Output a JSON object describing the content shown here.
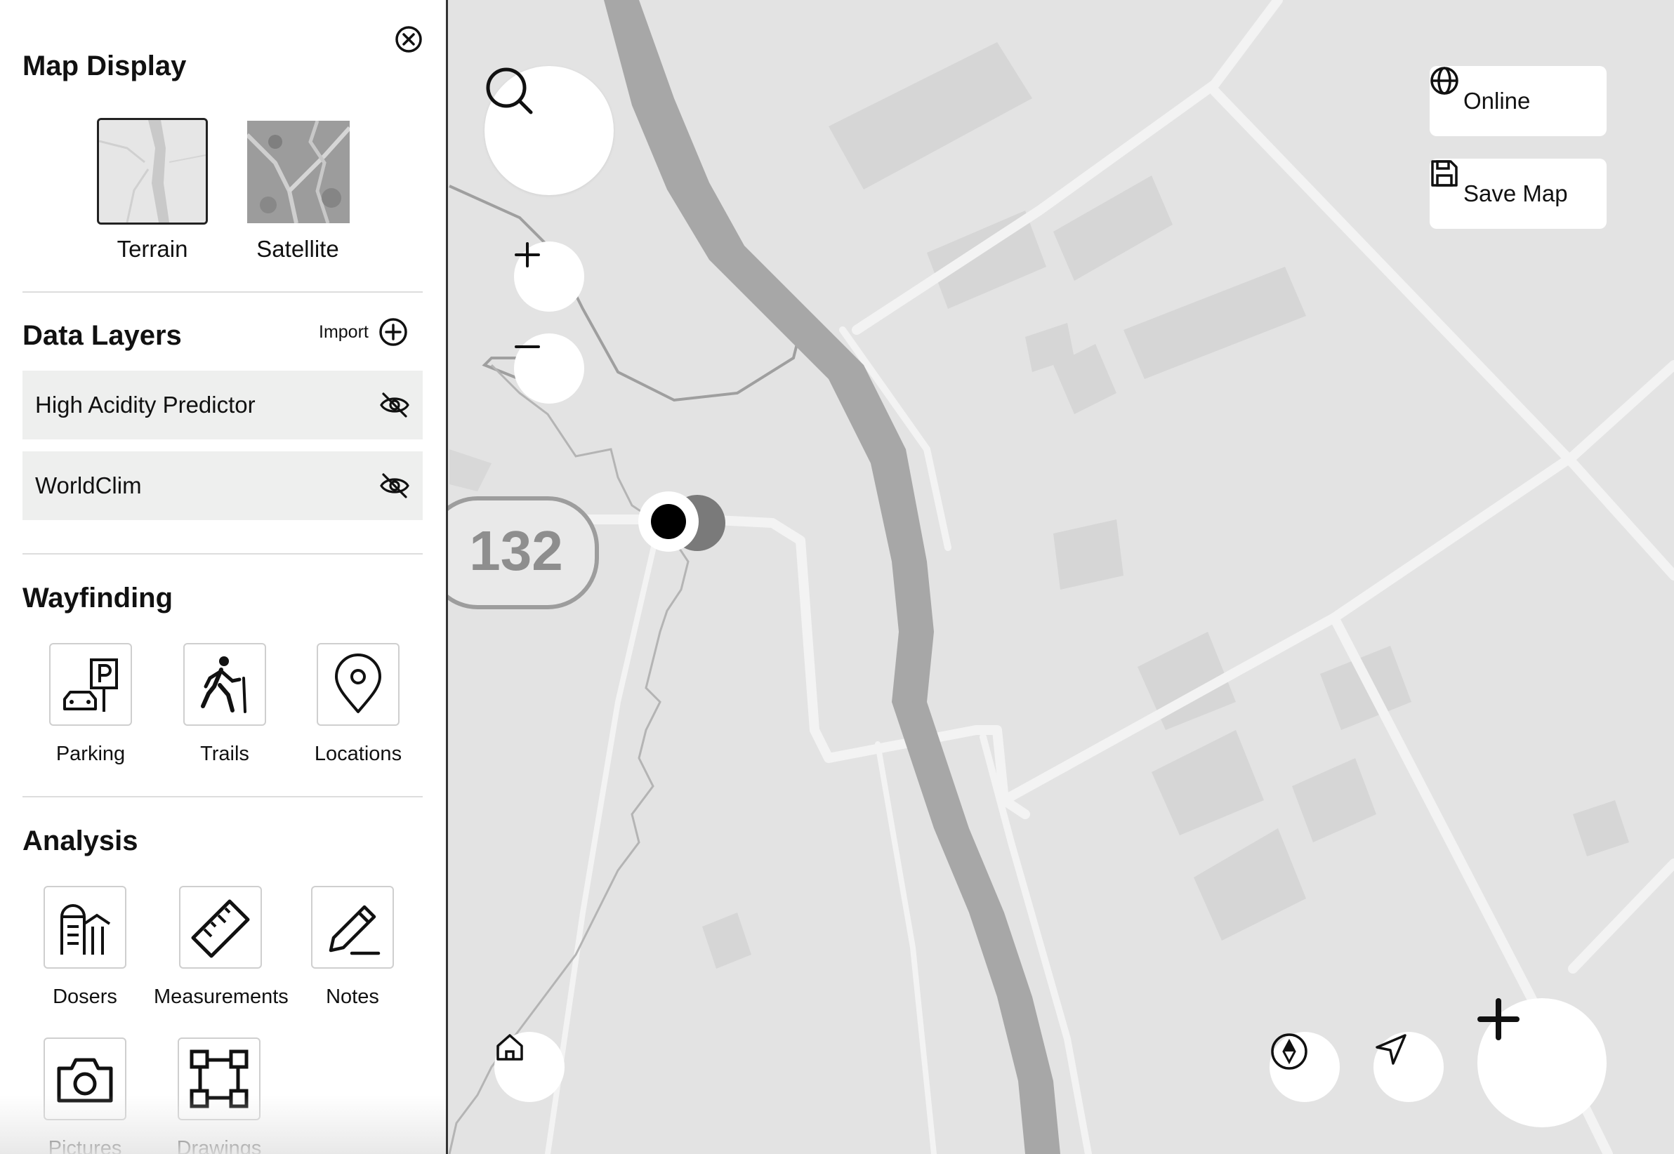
{
  "sidebar": {
    "map_display": {
      "title": "Map Display",
      "options": [
        {
          "label": "Terrain",
          "selected": true
        },
        {
          "label": "Satellite",
          "selected": false
        }
      ]
    },
    "data_layers": {
      "title": "Data Layers",
      "import_label": "Import",
      "layers": [
        {
          "name": "High Acidity Predictor",
          "visible": false
        },
        {
          "name": "WorldClim",
          "visible": false
        }
      ]
    },
    "wayfinding": {
      "title": "Wayfinding",
      "tools": [
        {
          "label": "Parking",
          "icon": "parking-icon"
        },
        {
          "label": "Trails",
          "icon": "hiker-icon"
        },
        {
          "label": "Locations",
          "icon": "map-pin-icon"
        }
      ]
    },
    "analysis": {
      "title": "Analysis",
      "tools": [
        {
          "label": "Dosers",
          "icon": "silo-icon"
        },
        {
          "label": "Measurements",
          "icon": "ruler-icon"
        },
        {
          "label": "Notes",
          "icon": "pencil-icon"
        },
        {
          "label": "Pictures",
          "icon": "camera-icon"
        },
        {
          "label": "Drawings",
          "icon": "vector-square-icon"
        }
      ]
    }
  },
  "map": {
    "route_shield": "132",
    "status": {
      "label": "Online",
      "icon": "globe-icon"
    },
    "save": {
      "label": "Save Map",
      "icon": "floppy-disk-icon"
    },
    "colors": {
      "background": "#e3e3e3",
      "river": "#a7a7a7",
      "road": "#f3f3f3",
      "panel": "#ffffff"
    }
  }
}
